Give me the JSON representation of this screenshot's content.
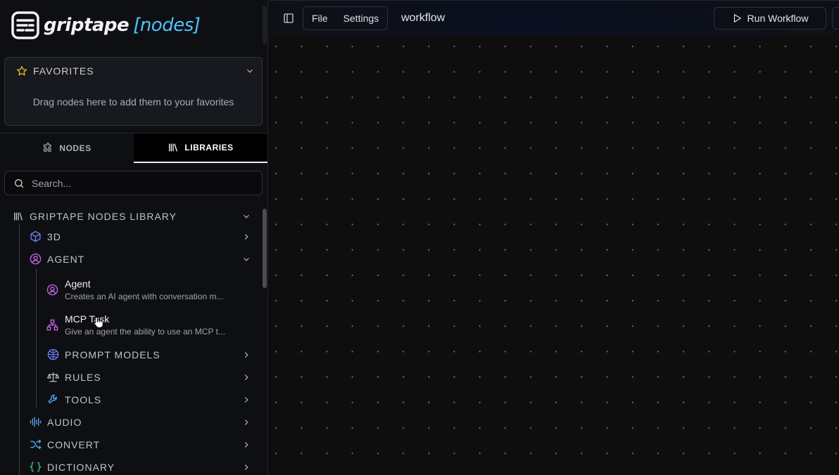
{
  "app": {
    "logo_name": "griptape",
    "logo_accent": "[nodes]"
  },
  "favorites": {
    "title": "FAVORITES",
    "empty_text": "Drag nodes here to add them to your favorites"
  },
  "tabs": [
    {
      "label": "NODES",
      "active": false
    },
    {
      "label": "LIBRARIES",
      "active": true
    }
  ],
  "search": {
    "placeholder": "Search...",
    "value": ""
  },
  "library": {
    "title": "GRIPTAPE NODES LIBRARY",
    "categories": [
      {
        "label": "3D",
        "icon": "cube-icon",
        "color": "#6b7cf5"
      },
      {
        "label": "AGENT",
        "icon": "agent-icon",
        "color": "#c060e0",
        "expanded": true,
        "items": [
          {
            "title": "Agent",
            "desc": "Creates an AI agent with conversation m...",
            "icon": "agent-icon"
          },
          {
            "title": "MCP Task",
            "desc": "Give an agent the ability to use an MCP t...",
            "icon": "network-icon"
          }
        ],
        "subcategories": [
          {
            "label": "PROMPT MODELS",
            "icon": "brain-icon",
            "color": "#6b7cf5"
          },
          {
            "label": "RULES",
            "icon": "scale-icon",
            "color": "#bfc3c9"
          },
          {
            "label": "TOOLS",
            "icon": "wrench-icon",
            "color": "#4fa3f0"
          }
        ]
      },
      {
        "label": "AUDIO",
        "icon": "audio-wave-icon",
        "color": "#4fa3f0"
      },
      {
        "label": "CONVERT",
        "icon": "shuffle-icon",
        "color": "#4fa3f0"
      },
      {
        "label": "DICTIONARY",
        "icon": "braces-icon",
        "color": "#3ec46d"
      }
    ]
  },
  "topbar": {
    "menu": [
      "File",
      "Settings"
    ],
    "workflow_name": "workflow",
    "run_label": "Run Workflow"
  },
  "colors": {
    "accent": "#4fc3f7",
    "star": "#e8b923"
  }
}
